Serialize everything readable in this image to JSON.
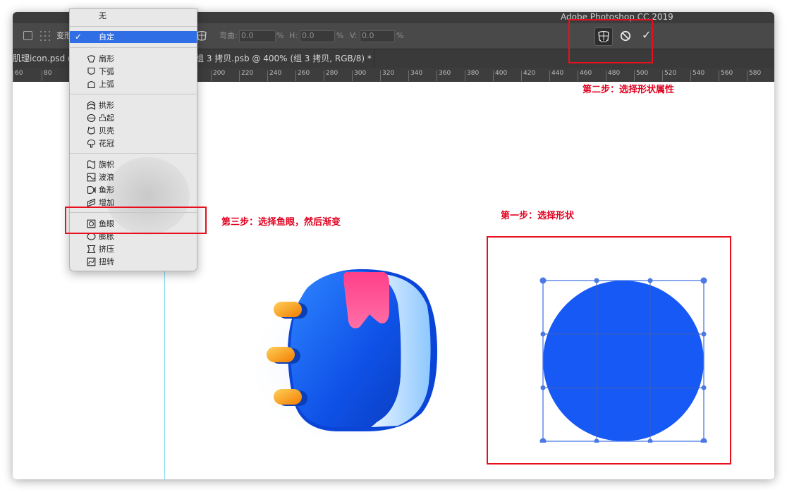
{
  "app": {
    "title": "Adobe Photoshop CC 2019"
  },
  "options": {
    "transform_label": "变形",
    "bend_label": "弯曲:",
    "bend_value": "0.0",
    "h_label": "H:",
    "h_value": "0.0",
    "v_label": "V:",
    "v_value": "0.0",
    "percent": "%",
    "confirm_symbol": "✓"
  },
  "tabs": [
    {
      "label": "肌理icon.psd @"
    },
    {
      "label": "组 3 拷贝.psb @ 400% (组 3 拷贝, RGB/8) *"
    }
  ],
  "ruler": {
    "labels": [
      "60",
      "80",
      "200",
      "220",
      "240",
      "260",
      "280",
      "300",
      "320",
      "340",
      "360",
      "380",
      "400",
      "420",
      "440",
      "460",
      "480",
      "500",
      "520",
      "540",
      "560",
      "580"
    ]
  },
  "warp_menu": {
    "none_label": "无",
    "custom_label": "自定",
    "checkmark": "✓",
    "groups": [
      [
        {
          "label": "扇形",
          "icon": "arc-icon"
        },
        {
          "label": "下弧",
          "icon": "arc-lower-icon"
        },
        {
          "label": "上弧",
          "icon": "arc-upper-icon"
        }
      ],
      [
        {
          "label": "拱形",
          "icon": "arch-icon"
        },
        {
          "label": "凸起",
          "icon": "bulge-icon"
        },
        {
          "label": "贝壳",
          "icon": "shell-icon"
        },
        {
          "label": "花冠",
          "icon": "flower-icon"
        }
      ],
      [
        {
          "label": "旗帜",
          "icon": "flag-icon"
        },
        {
          "label": "波浪",
          "icon": "wave-icon"
        },
        {
          "label": "鱼形",
          "icon": "fish-icon"
        },
        {
          "label": "增加",
          "icon": "rise-icon"
        }
      ],
      [
        {
          "label": "鱼眼",
          "icon": "fisheye-icon"
        },
        {
          "label": "膨胀",
          "icon": "inflate-icon"
        },
        {
          "label": "挤压",
          "icon": "squeeze-icon"
        },
        {
          "label": "扭转",
          "icon": "twist-icon"
        }
      ]
    ]
  },
  "annotations": {
    "step1": "第一步：选择形状",
    "step2": "第二步：选择形状属性",
    "step3": "第三步：选择鱼眼，然后渐变"
  },
  "colors": {
    "annotation": "#e8101e",
    "shape_fill": "#1659f5",
    "warp_grid": "#4a78e6",
    "menu_highlight": "#2f6ee4"
  }
}
